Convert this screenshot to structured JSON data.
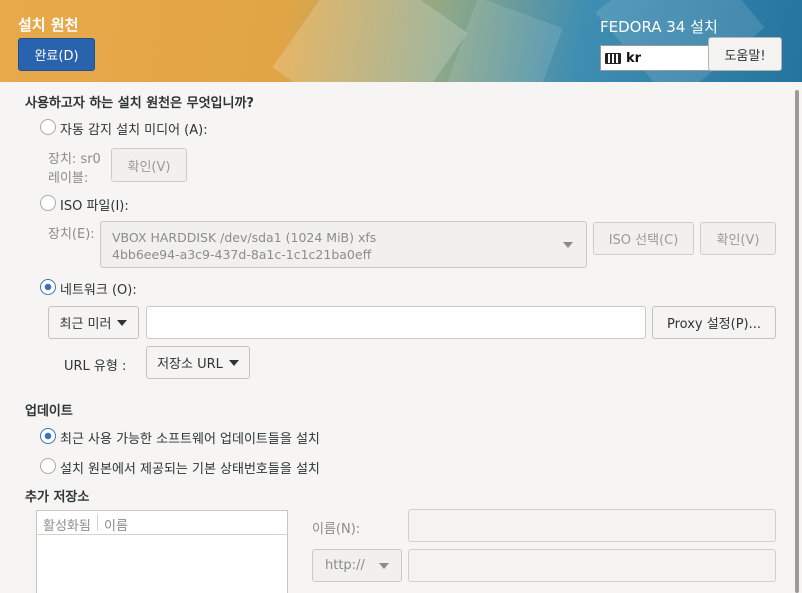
{
  "header": {
    "title": "설치 원천",
    "done_label": "완료(D)",
    "product": "FEDORA 34 설치",
    "keyboard_layout": "kr",
    "help_label": "도움말!"
  },
  "source": {
    "question": "사용하고자 하는 설치 원천은 무엇입니까?",
    "auto_media_label": "자동 감지 설치 미디어 (A):",
    "device_label": "장치: sr0",
    "volume_label": "레이블:",
    "verify_label": "확인(V)",
    "iso_label": "ISO 파일(I):",
    "iso_device_label": "장치(E):",
    "iso_device_line1": "VBOX HARDDISK /dev/sda1 (1024 MiB) xfs",
    "iso_device_line2": "4bb6ee94-a3c9-437d-8a1c-1c1c21ba0eff",
    "iso_select_label": "ISO 선택(C)",
    "iso_verify_label": "확인(V)",
    "network_label": "네트워크 (O):",
    "mirror_label": "최근 미러",
    "url_value": "",
    "proxy_label": "Proxy 설정(P)...",
    "url_type_label": "URL 유형 :",
    "url_type_value": "저장소 URL"
  },
  "updates": {
    "title": "업데이트",
    "option1": "최근 사용 가능한 소프트웨어 업데이트들을 설치",
    "option2": "설치 원본에서 제공되는 기본 상태번호들을 설치",
    "option1_selected": true
  },
  "repos": {
    "title": "추가 저장소",
    "col_enabled": "활성화됨",
    "col_name": "이름",
    "name_label": "이름(N):",
    "protocol_value": "http://"
  },
  "colors": {
    "accent": "#3b73b9",
    "done_button": "#2a63ad"
  }
}
